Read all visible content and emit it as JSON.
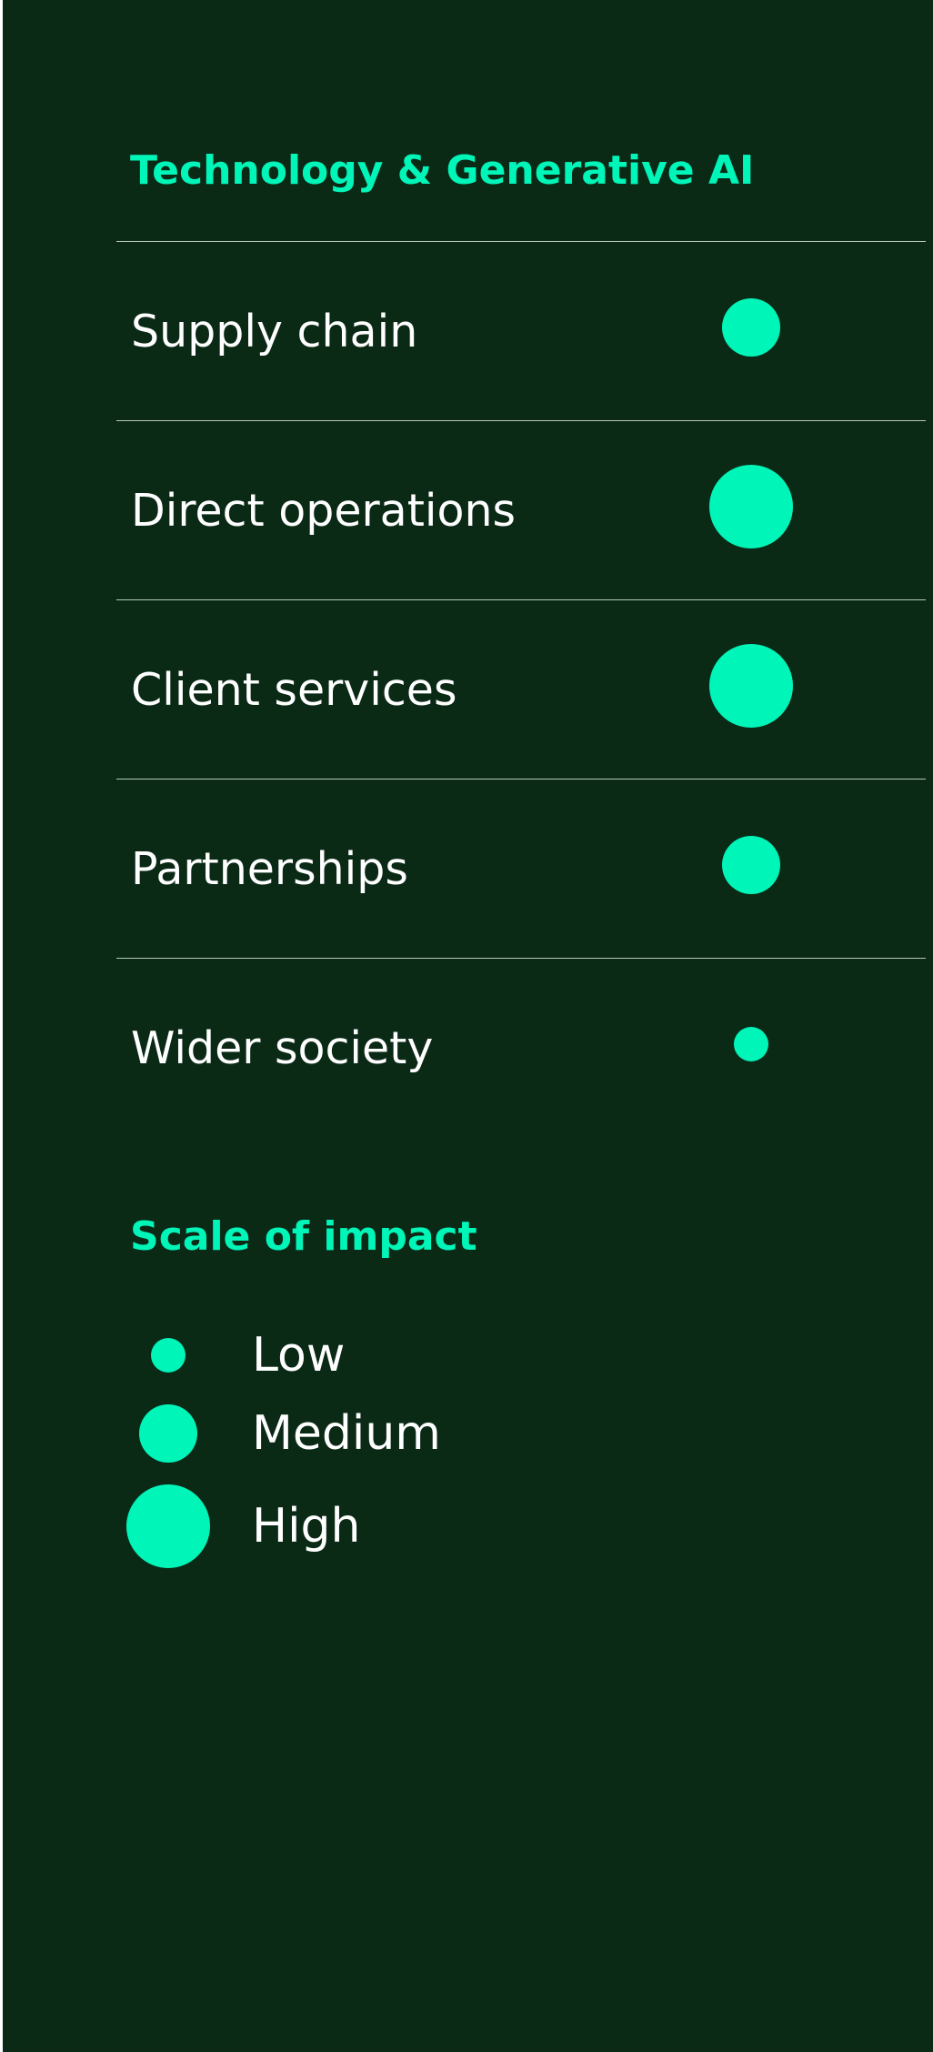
{
  "chart_data": {
    "type": "bubble-matrix",
    "title": "Technology & Generative AI",
    "rows": [
      {
        "label": "Supply chain",
        "impact": "Medium"
      },
      {
        "label": "Direct operations",
        "impact": "High"
      },
      {
        "label": "Client services",
        "impact": "High"
      },
      {
        "label": "Partnerships",
        "impact": "Medium"
      },
      {
        "label": "Wider society",
        "impact": "Low"
      }
    ],
    "legend": {
      "title": "Scale of impact",
      "levels": [
        "Low",
        "Medium",
        "High"
      ]
    }
  },
  "colors": {
    "background": "#0a2a16",
    "accent": "#00f5b8",
    "text": "#ffffff",
    "divider": "#b6c7bd"
  }
}
